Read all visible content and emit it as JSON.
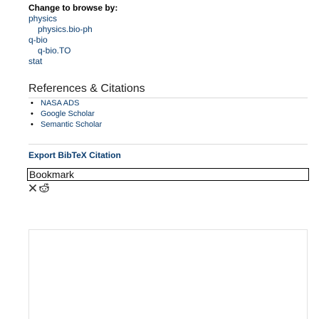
{
  "browse": {
    "title": "Change to browse by:",
    "items": [
      {
        "label": "physics",
        "level": 0
      },
      {
        "label": "physics.bio-ph",
        "level": 1
      },
      {
        "label": "q-bio",
        "level": 0
      },
      {
        "label": "q-bio.TO",
        "level": 1
      },
      {
        "label": "stat",
        "level": 0
      }
    ]
  },
  "references": {
    "title": "References & Citations",
    "items": [
      "NASA ADS",
      "Google Scholar",
      "Semantic Scholar"
    ]
  },
  "export": {
    "label": "Export BibTeX Citation"
  },
  "bookmark": {
    "label": "Bookmark",
    "icons": [
      "x-icon",
      "reddit-icon"
    ]
  }
}
